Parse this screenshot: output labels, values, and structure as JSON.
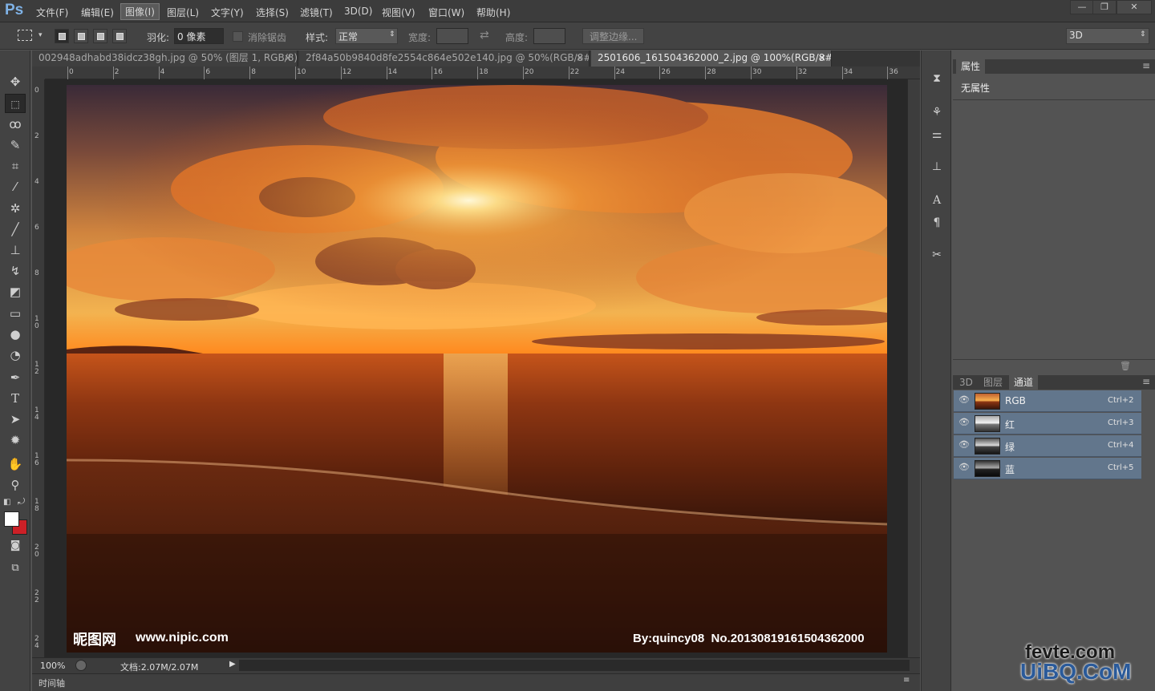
{
  "app": {
    "logo": "Ps"
  },
  "menu": [
    "文件(F)",
    "编辑(E)",
    "图像(I)",
    "图层(L)",
    "文字(Y)",
    "选择(S)",
    "滤镜(T)",
    "3D(D)",
    "视图(V)",
    "窗口(W)",
    "帮助(H)"
  ],
  "window_buttons": {
    "minimize": "—",
    "restore": "❐",
    "close": "✕"
  },
  "options": {
    "feather_label": "羽化:",
    "feather_value": "0 像素",
    "antialias_label": "消除锯齿",
    "style_label": "样式:",
    "style_value": "正常",
    "width_label": "宽度:",
    "height_label": "高度:",
    "refine_edge": "调整边缘...",
    "workspace": "3D"
  },
  "doc_tabs": [
    {
      "title": "002948adhabd38idcz38gh.jpg @ 50% (图层 1, RGB/8) *",
      "close": "×"
    },
    {
      "title": "2f84a50b9840d8fe2554c864e502e140.jpg @ 50%(RGB/8#) *",
      "close": "×"
    },
    {
      "title": "2501606_161504362000_2.jpg @ 100%(RGB/8#)",
      "close": "×"
    }
  ],
  "ruler_top": [
    "0",
    "2",
    "4",
    "6",
    "8",
    "10",
    "12",
    "14",
    "16",
    "18",
    "20",
    "22",
    "24",
    "26",
    "28",
    "30",
    "32",
    "34",
    "36"
  ],
  "ruler_left": [
    "0",
    "2",
    "4",
    "6",
    "8",
    "1 0",
    "1 2",
    "1 4",
    "1 6",
    "1 8",
    "2 0",
    "2 2",
    "2 4"
  ],
  "image_watermark": {
    "left_logo": "昵图网",
    "left_url": "www.nipic.com",
    "right_text": "By:quincy08  No.20130819161504362000"
  },
  "status": {
    "zoom": "100%",
    "doc_info": "文档:2.07M/2.07M"
  },
  "timeline_label": "时间轴",
  "properties_panel": {
    "tab": "属性",
    "content": "无属性"
  },
  "channels_panel": {
    "tabs": [
      "3D",
      "图层",
      "通道"
    ],
    "active_tab": "通道",
    "channels": [
      {
        "name": "RGB",
        "shortcut": "Ctrl+2"
      },
      {
        "name": "红",
        "shortcut": "Ctrl+3"
      },
      {
        "name": "绿",
        "shortcut": "Ctrl+4"
      },
      {
        "name": "蓝",
        "shortcut": "Ctrl+5"
      }
    ]
  },
  "site_watermark": {
    "line1": "fevte.com",
    "line2": "UiBQ.CoM"
  },
  "colors": {
    "foreground": "#ffffff",
    "background": "#cc2027",
    "accent_selection": "#62768c"
  }
}
